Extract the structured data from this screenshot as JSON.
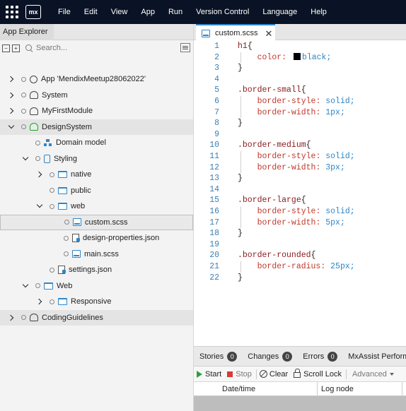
{
  "menubar": {
    "logo_text": "mx",
    "items": [
      "File",
      "Edit",
      "View",
      "App",
      "Run",
      "Version Control",
      "Language",
      "Help"
    ]
  },
  "explorer": {
    "tab_label": "App Explorer",
    "search_placeholder": "Search...",
    "tree": [
      {
        "label": "App 'MendixMeetup28062022'",
        "icon": "app-icon",
        "depth": 0,
        "expander": "right"
      },
      {
        "label": "System",
        "icon": "module-icon",
        "depth": 0,
        "expander": "right"
      },
      {
        "label": "MyFirstModule",
        "icon": "module-icon",
        "depth": 0,
        "expander": "right"
      },
      {
        "label": "DesignSystem",
        "icon": "module-icon-green",
        "depth": 0,
        "expander": "down",
        "shaded": true
      },
      {
        "label": "Domain model",
        "icon": "domain-model-icon",
        "depth": 1,
        "expander": "none"
      },
      {
        "label": "Styling",
        "icon": "styling-icon",
        "depth": 1,
        "expander": "down"
      },
      {
        "label": "native",
        "icon": "folder-icon",
        "depth": 2,
        "expander": "right"
      },
      {
        "label": "public",
        "icon": "folder-icon",
        "depth": 2,
        "expander": "none"
      },
      {
        "label": "web",
        "icon": "folder-icon",
        "depth": 2,
        "expander": "down"
      },
      {
        "label": "custom.scss",
        "icon": "scss-file-icon",
        "depth": 3,
        "expander": "none",
        "selected": true
      },
      {
        "label": "design-properties.json",
        "icon": "json-file-icon",
        "depth": 3,
        "expander": "none"
      },
      {
        "label": "main.scss",
        "icon": "scss-file-icon",
        "depth": 3,
        "expander": "none"
      },
      {
        "label": "settings.json",
        "icon": "json-file-icon",
        "depth": 2,
        "expander": "none"
      },
      {
        "label": "Web",
        "icon": "folder-icon",
        "depth": 1,
        "expander": "down"
      },
      {
        "label": "Responsive",
        "icon": "folder-icon",
        "depth": 2,
        "expander": "right"
      },
      {
        "label": "CodingGuidelines",
        "icon": "module-icon",
        "depth": 0,
        "expander": "right",
        "shaded": true
      }
    ]
  },
  "editor": {
    "tab_label": "custom.scss",
    "close_glyph": "✕",
    "lines": [
      {
        "n": "1",
        "sel": "h1",
        "pun": "{"
      },
      {
        "n": "2",
        "prop": "color",
        "val": "black",
        "swatch": true
      },
      {
        "n": "3",
        "pun": "}"
      },
      {
        "n": "4"
      },
      {
        "n": "5",
        "sel": ".border-small",
        "pun": "{"
      },
      {
        "n": "6",
        "prop": "border-style",
        "val": "solid"
      },
      {
        "n": "7",
        "prop": "border-width",
        "val": "1px"
      },
      {
        "n": "8",
        "pun": "}"
      },
      {
        "n": "9"
      },
      {
        "n": "10",
        "sel": ".border-medium",
        "pun": "{"
      },
      {
        "n": "11",
        "prop": "border-style",
        "val": "solid"
      },
      {
        "n": "12",
        "prop": "border-width",
        "val": "3px"
      },
      {
        "n": "13",
        "pun": "}"
      },
      {
        "n": "14"
      },
      {
        "n": "15",
        "sel": ".border-large",
        "pun": "{"
      },
      {
        "n": "16",
        "prop": "border-style",
        "val": "solid"
      },
      {
        "n": "17",
        "prop": "border-width",
        "val": "5px"
      },
      {
        "n": "18",
        "pun": "}"
      },
      {
        "n": "19"
      },
      {
        "n": "20",
        "sel": ".border-rounded",
        "pun": "{"
      },
      {
        "n": "21",
        "prop": "border-radius",
        "val": "25px"
      },
      {
        "n": "22",
        "pun": "}"
      }
    ]
  },
  "bottom": {
    "tabs": [
      {
        "label": "Stories",
        "count": "0"
      },
      {
        "label": "Changes",
        "count": "0"
      },
      {
        "label": "Errors",
        "count": "0"
      },
      {
        "label": "MxAssist Perform",
        "count": ""
      }
    ],
    "toolbar": {
      "start": "Start",
      "stop": "Stop",
      "clear": "Clear",
      "scroll_lock": "Scroll Lock",
      "advanced": "Advanced"
    },
    "columns": {
      "date": "Date/time",
      "node": "Log node"
    }
  },
  "colors": {
    "menubar_bg": "#0a1325",
    "accent": "#2f86c8",
    "selector": "#8b1b1b",
    "property": "#c0392b",
    "value": "#2f86c8"
  }
}
